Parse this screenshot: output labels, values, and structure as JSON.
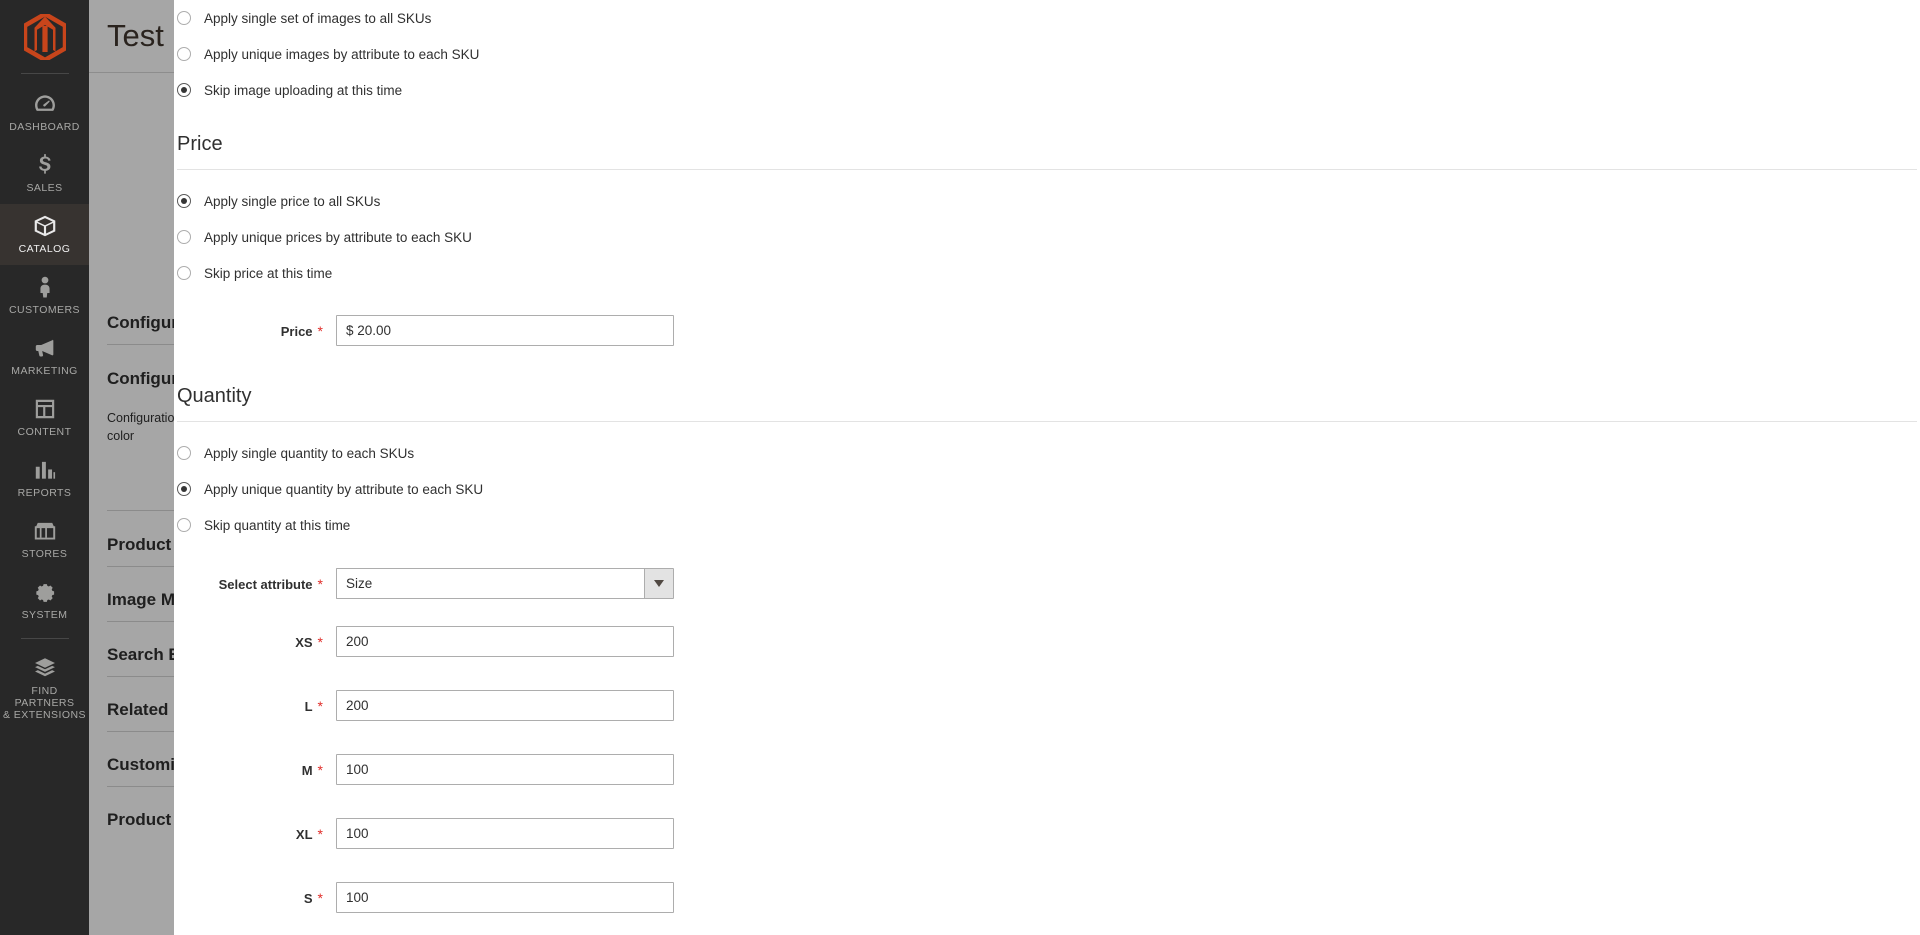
{
  "sidebar": {
    "logo_name": "magento-logo",
    "items": [
      {
        "label": "DASHBOARD",
        "icon": "dashboard-icon",
        "active": false
      },
      {
        "label": "SALES",
        "icon": "dollar-icon",
        "active": false
      },
      {
        "label": "CATALOG",
        "icon": "box-icon",
        "active": true
      },
      {
        "label": "CUSTOMERS",
        "icon": "person-icon",
        "active": false
      },
      {
        "label": "MARKETING",
        "icon": "megaphone-icon",
        "active": false
      },
      {
        "label": "CONTENT",
        "icon": "layout-icon",
        "active": false
      },
      {
        "label": "REPORTS",
        "icon": "bar-chart-icon",
        "active": false
      },
      {
        "label": "STORES",
        "icon": "storefront-icon",
        "active": false
      },
      {
        "label": "SYSTEM",
        "icon": "gear-icon",
        "active": false
      },
      {
        "label": "FIND PARTNERS\n& EXTENSIONS",
        "icon": "extensions-icon",
        "active": false
      }
    ]
  },
  "background_page": {
    "title": "Test",
    "sections": [
      "Configurations",
      "Configurations",
      "Product in Websites",
      "Image Management",
      "Search Engine Optimization",
      "Related Products, Up-Sells, and Cross-Sells",
      "Customizable Options",
      "Product"
    ],
    "note_line1": "Configurations",
    "note_line2": "color"
  },
  "modal": {
    "images": {
      "options": [
        {
          "label": "Apply single set of images to all SKUs",
          "checked": false
        },
        {
          "label": "Apply unique images by attribute to each SKU",
          "checked": false
        },
        {
          "label": "Skip image uploading at this time",
          "checked": true
        }
      ]
    },
    "price": {
      "heading": "Price",
      "options": [
        {
          "label": "Apply single price to all SKUs",
          "checked": true
        },
        {
          "label": "Apply unique prices by attribute to each SKU",
          "checked": false
        },
        {
          "label": "Skip price at this time",
          "checked": false
        }
      ],
      "field_label": "Price",
      "field_value": "$ 20.00"
    },
    "quantity": {
      "heading": "Quantity",
      "options": [
        {
          "label": "Apply single quantity to each SKUs",
          "checked": false
        },
        {
          "label": "Apply unique quantity by attribute to each SKU",
          "checked": true
        },
        {
          "label": "Skip quantity at this time",
          "checked": false
        }
      ],
      "select_label": "Select attribute",
      "select_value": "Size",
      "qty_fields": [
        {
          "label": "XS",
          "value": "200"
        },
        {
          "label": "L",
          "value": "200"
        },
        {
          "label": "M",
          "value": "100"
        },
        {
          "label": "XL",
          "value": "100"
        },
        {
          "label": "S",
          "value": "100"
        }
      ]
    }
  },
  "colors": {
    "brand_orange": "#e25b26",
    "sidebar_bg": "#282828",
    "required_red": "#e02b27"
  }
}
